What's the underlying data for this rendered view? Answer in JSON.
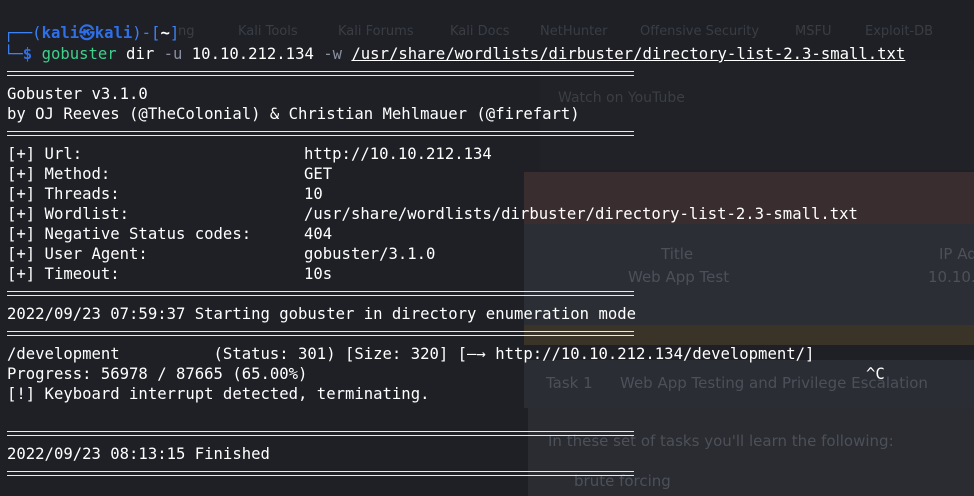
{
  "background": {
    "toolbar_items": [
      "ng",
      "Kali Tools",
      "Kali Forums",
      "Kali Docs",
      "NetHunter",
      "Offensive Security",
      "MSFU",
      "Exploit-DB"
    ],
    "video_text": "Watch on  YouTube",
    "card_columns": [
      "Title",
      "IP Ad"
    ],
    "card_values": [
      "Web App Test",
      "10.10."
    ],
    "task_label": "Task 1",
    "task_title": "Web App Testing and Privilege Escalation",
    "panel_intro": "In these set of tasks you'll learn the following:",
    "panel_bullet": "brute forcing"
  },
  "prompt": {
    "open": "┌──(",
    "user": "kali㉿kali",
    "mid": ")-[",
    "dir": "~",
    "close": "]",
    "arrow": "└─",
    "dollar": "$"
  },
  "command": {
    "program": "gobuster",
    "subcommand": " dir ",
    "flag_u": "-u",
    "url": " 10.10.212.134 ",
    "flag_w": "-w",
    "wordlist": "/usr/share/wordlists/dirbuster/directory-list-2.3-small.txt"
  },
  "banner": {
    "version": "Gobuster v3.1.0",
    "authors": "by OJ Reeves (@TheColonial) & Christian Mehlmauer (@firefart)"
  },
  "config": [
    {
      "key": "[+] Url:",
      "value": "http://10.10.212.134"
    },
    {
      "key": "[+] Method:",
      "value": "GET"
    },
    {
      "key": "[+] Threads:",
      "value": "10"
    },
    {
      "key": "[+] Wordlist:",
      "value": "/usr/share/wordlists/dirbuster/directory-list-2.3-small.txt"
    },
    {
      "key": "[+] Negative Status codes:",
      "value": "404"
    },
    {
      "key": "[+] User Agent:",
      "value": "gobuster/3.1.0"
    },
    {
      "key": "[+] Timeout:",
      "value": "10s"
    }
  ],
  "start_line": "2022/09/23 07:59:37 Starting gobuster in directory enumeration mode",
  "results": {
    "found": "/development          (Status: 301) [Size: 320] [—→ http://10.10.212.134/development/]",
    "progress": "Progress: 56978 / 87665 (65.00%)",
    "ctrl_c": "^C",
    "interrupt": "[!] Keyboard interrupt detected, terminating."
  },
  "finish_line": "2022/09/23 08:13:15 Finished"
}
